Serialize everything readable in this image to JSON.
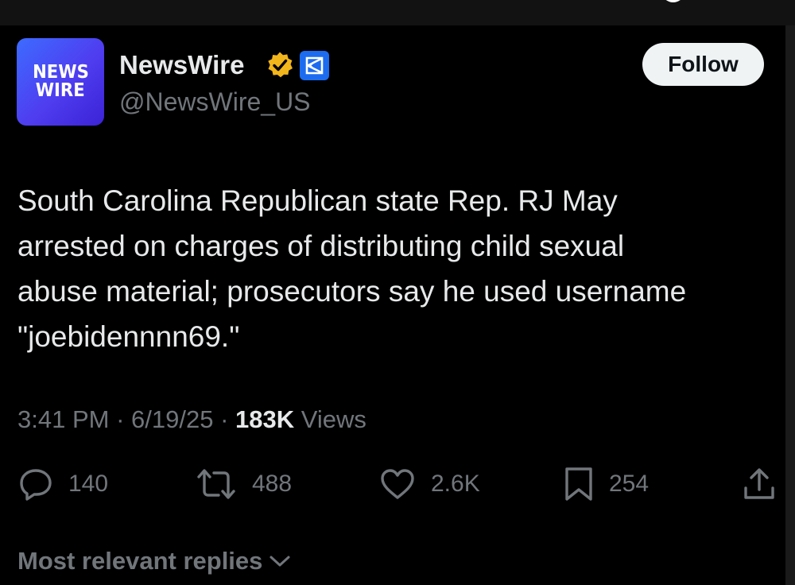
{
  "account": {
    "avatar_line1": "NEWS",
    "avatar_line2": "WIRE",
    "display_name": "NewsWire",
    "handle": "@NewsWire_US",
    "verified_badge_icon": "gold-verified-badge-icon",
    "affiliate_badge_icon": "affiliate-badge-icon",
    "brand_gradient": [
      "#3d6bff",
      "#3b22d6"
    ]
  },
  "follow_button": {
    "label": "Follow"
  },
  "tweet": {
    "text": "South Carolina Republican state Rep. RJ May\narrested on charges of distributing child sexual\nabuse material; prosecutors say he used username\n\"joebidennnn69.\"",
    "time": "3:41 PM",
    "separator": "·",
    "date": "6/19/25",
    "views_count": "183K",
    "views_label": "Views"
  },
  "actions": [
    {
      "icon": "reply-icon",
      "count": "140"
    },
    {
      "icon": "retweet-icon",
      "count": "488"
    },
    {
      "icon": "like-icon",
      "count": "2.6K"
    },
    {
      "icon": "bookmark-icon",
      "count": "254"
    },
    {
      "icon": "share-icon",
      "count": ""
    }
  ],
  "replies_sort": {
    "label": "Most relevant replies",
    "icon": "chevron-down-icon"
  },
  "colors": {
    "background": "#000000",
    "text_primary": "#e7e9ea",
    "text_secondary": "#71767b",
    "verified_gold": "#f2b51b",
    "affiliate_blue": "#1d6cf0"
  }
}
